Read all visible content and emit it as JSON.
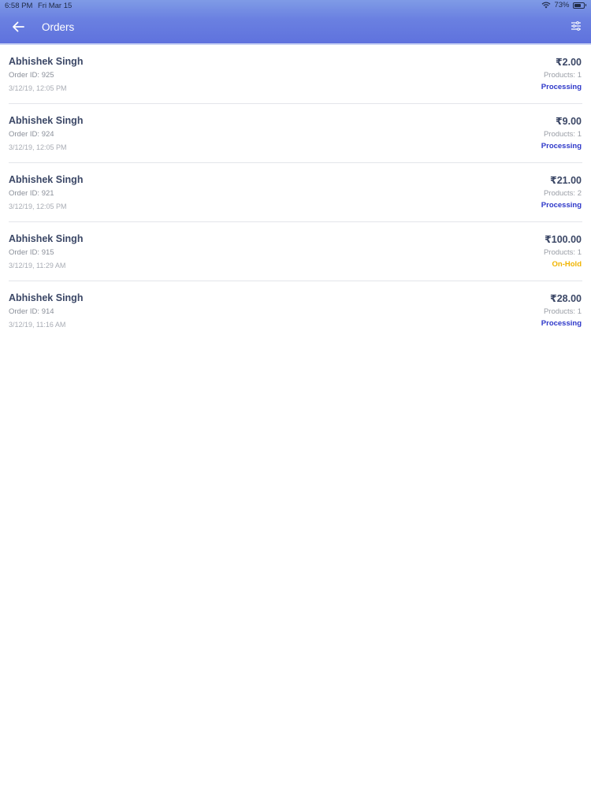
{
  "status_bar": {
    "time": "6:58 PM",
    "date": "Fri Mar 15",
    "battery": "73%",
    "battery_level": 0.73
  },
  "header": {
    "title": "Orders",
    "back_icon": "arrow-left-icon",
    "filter_icon": "filter-icon"
  },
  "colors": {
    "header_gradient_top": "#7f9be6",
    "header_gradient_bottom": "#5f72dd",
    "processing": "#2e38c9",
    "on_hold": "#f0b400",
    "name_text": "#3b4766"
  },
  "orders": [
    {
      "customer": "Abhishek Singh",
      "order_id": "Order ID: 925",
      "date": "3/12/19, 12:05 PM",
      "amount": "₹2.00",
      "products": "Products: 1",
      "status": "Processing"
    },
    {
      "customer": "Abhishek Singh",
      "order_id": "Order ID: 924",
      "date": "3/12/19, 12:05 PM",
      "amount": "₹9.00",
      "products": "Products: 1",
      "status": "Processing"
    },
    {
      "customer": "Abhishek Singh",
      "order_id": "Order ID: 921",
      "date": "3/12/19, 12:05 PM",
      "amount": "₹21.00",
      "products": "Products: 2",
      "status": "Processing"
    },
    {
      "customer": "Abhishek Singh",
      "order_id": "Order ID: 915",
      "date": "3/12/19, 11:29 AM",
      "amount": "₹100.00",
      "products": "Products: 1",
      "status": "On-Hold"
    },
    {
      "customer": "Abhishek Singh",
      "order_id": "Order ID: 914",
      "date": "3/12/19, 11:16 AM",
      "amount": "₹28.00",
      "products": "Products: 1",
      "status": "Processing"
    }
  ]
}
